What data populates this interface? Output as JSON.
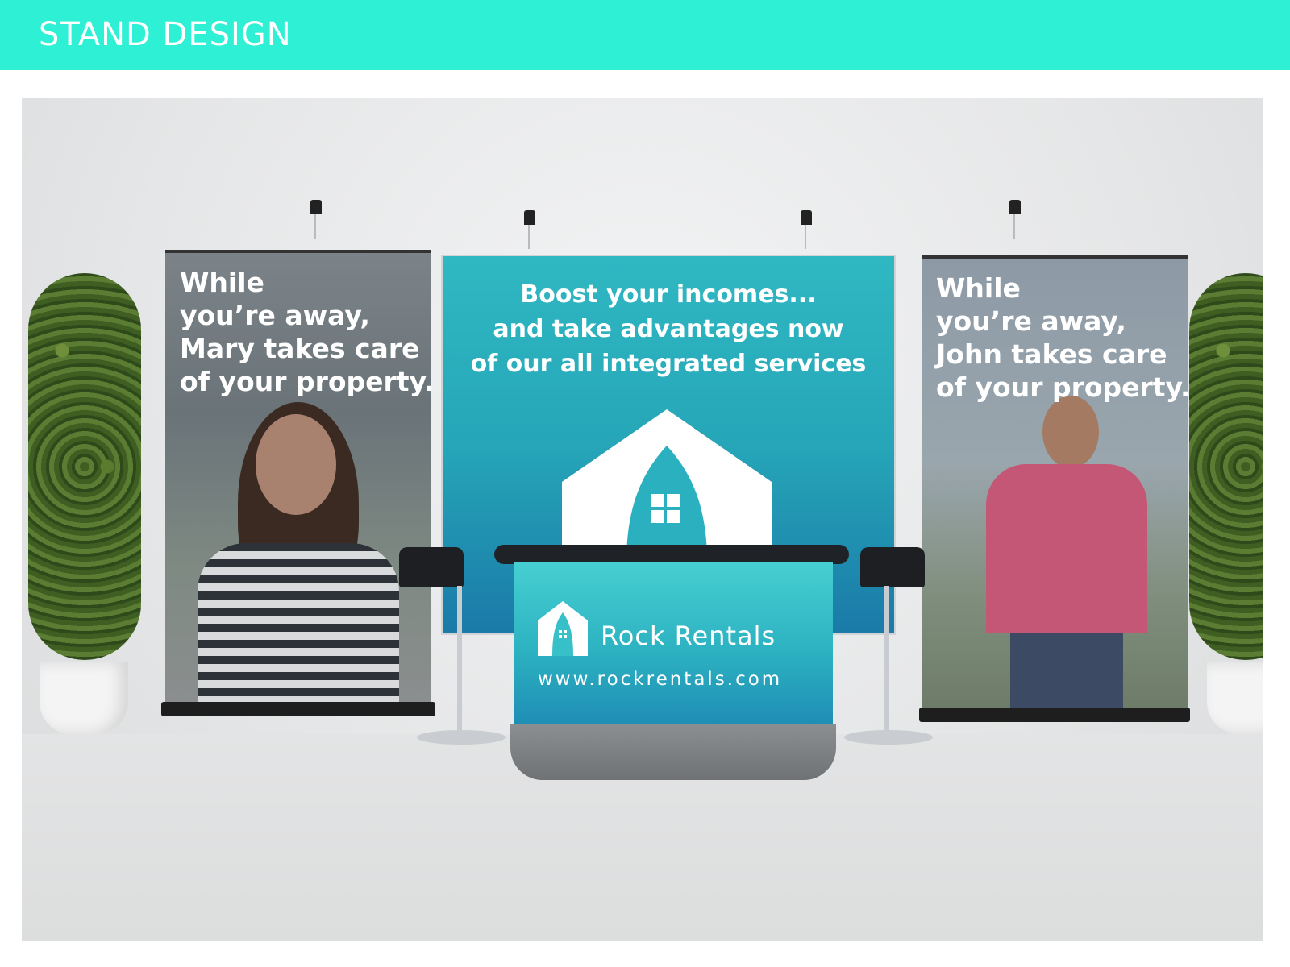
{
  "header": {
    "title": "STAND DESIGN",
    "color": "#2ef0d4"
  },
  "left_banner": {
    "lines": [
      "While",
      "you’re away,",
      "Mary takes care",
      "of your property."
    ]
  },
  "back_wall": {
    "lines": [
      "Boost your incomes...",
      "and take advantages now",
      "of our all integrated services"
    ],
    "logo_icon": "house-rocket-icon",
    "color": "#2fb8c2"
  },
  "right_banner": {
    "lines": [
      "While",
      "you’re away,",
      "John takes care",
      "of your property."
    ]
  },
  "counter": {
    "logo_icon": "house-rocket-icon",
    "brand": "Rock Rentals",
    "url": "www.rockrentals.com"
  }
}
